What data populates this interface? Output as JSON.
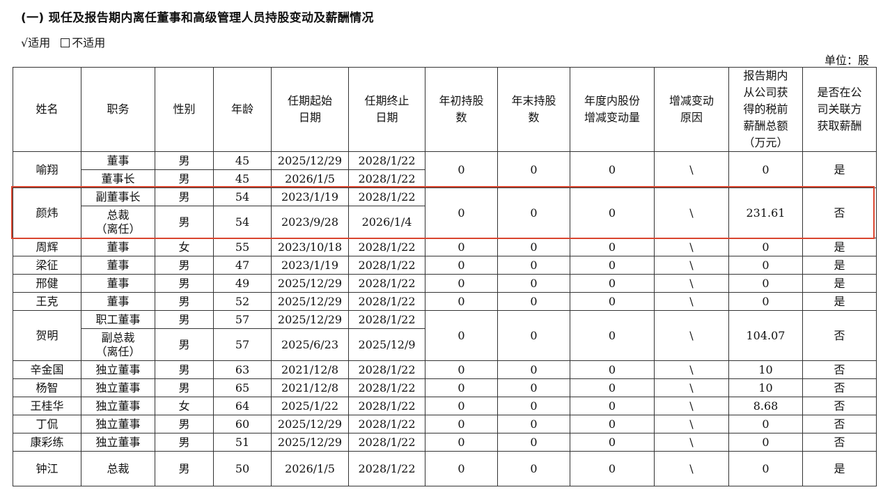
{
  "heading": "(一) 现任及报告期内离任董事和高级管理人员持股变动及薪酬情况",
  "applicability": {
    "checked": "√适用",
    "unchecked": "不适用"
  },
  "unit": "单位：股",
  "columns": [
    [
      "姓名"
    ],
    [
      "职务"
    ],
    [
      "性别"
    ],
    [
      "年龄"
    ],
    [
      "任期起始",
      "日期"
    ],
    [
      "任期终止",
      "日期"
    ],
    [
      "年初持股",
      "数"
    ],
    [
      "年末持股",
      "数"
    ],
    [
      "年度内股份",
      "增减变动量"
    ],
    [
      "增减变动",
      "原因"
    ],
    [
      "报告期内",
      "从公司获",
      "得的税前",
      "薪酬总额",
      "（万元）"
    ],
    [
      "是否在公",
      "司关联方",
      "获取薪酬"
    ]
  ],
  "persons": [
    {
      "name": "喻翔",
      "shares_begin": "0",
      "shares_end": "0",
      "change": "0",
      "reason": "\\",
      "pay": "0",
      "related": "是",
      "roles": [
        {
          "title": [
            "董事"
          ],
          "gender": "男",
          "age": "45",
          "start": "2025/12/29",
          "end": "2028/1/22"
        },
        {
          "title": [
            "董事长"
          ],
          "gender": "男",
          "age": "45",
          "start": "2026/1/5",
          "end": "2028/1/22"
        }
      ]
    },
    {
      "name": "颜炜",
      "shares_begin": "0",
      "shares_end": "0",
      "change": "0",
      "reason": "\\",
      "pay": "231.61",
      "related": "否",
      "roles": [
        {
          "title": [
            "副董事长"
          ],
          "gender": "男",
          "age": "54",
          "start": "2023/1/19",
          "end": "2028/1/22"
        },
        {
          "title": [
            "总裁",
            "（离任）"
          ],
          "gender": "男",
          "age": "54",
          "start": "2023/9/28",
          "end": "2026/1/4"
        }
      ]
    },
    {
      "name": "周辉",
      "shares_begin": "0",
      "shares_end": "0",
      "change": "0",
      "reason": "\\",
      "pay": "0",
      "related": "是",
      "roles": [
        {
          "title": [
            "董事"
          ],
          "gender": "女",
          "age": "55",
          "start": "2023/10/18",
          "end": "2028/1/22"
        }
      ]
    },
    {
      "name": "梁征",
      "shares_begin": "0",
      "shares_end": "0",
      "change": "0",
      "reason": "\\",
      "pay": "0",
      "related": "是",
      "roles": [
        {
          "title": [
            "董事"
          ],
          "gender": "男",
          "age": "47",
          "start": "2023/1/19",
          "end": "2028/1/22"
        }
      ]
    },
    {
      "name": "邢健",
      "shares_begin": "0",
      "shares_end": "0",
      "change": "0",
      "reason": "\\",
      "pay": "0",
      "related": "是",
      "roles": [
        {
          "title": [
            "董事"
          ],
          "gender": "男",
          "age": "49",
          "start": "2025/12/29",
          "end": "2028/1/22"
        }
      ]
    },
    {
      "name": "王克",
      "shares_begin": "0",
      "shares_end": "0",
      "change": "0",
      "reason": "\\",
      "pay": "0",
      "related": "是",
      "roles": [
        {
          "title": [
            "董事"
          ],
          "gender": "男",
          "age": "52",
          "start": "2025/12/29",
          "end": "2028/1/22"
        }
      ]
    },
    {
      "name": "贺明",
      "shares_begin": "0",
      "shares_end": "0",
      "change": "0",
      "reason": "\\",
      "pay": "104.07",
      "related": "否",
      "roles": [
        {
          "title": [
            "职工董事"
          ],
          "gender": "男",
          "age": "57",
          "start": "2025/12/29",
          "end": "2028/1/22"
        },
        {
          "title": [
            "副总裁",
            "（离任）"
          ],
          "gender": "男",
          "age": "57",
          "start": "2025/6/23",
          "end": "2025/12/9"
        }
      ]
    },
    {
      "name": "辛金国",
      "shares_begin": "0",
      "shares_end": "0",
      "change": "0",
      "reason": "\\",
      "pay": "10",
      "related": "否",
      "roles": [
        {
          "title": [
            "独立董事"
          ],
          "gender": "男",
          "age": "63",
          "start": "2021/12/8",
          "end": "2028/1/22"
        }
      ]
    },
    {
      "name": "杨智",
      "shares_begin": "0",
      "shares_end": "0",
      "change": "0",
      "reason": "\\",
      "pay": "10",
      "related": "否",
      "roles": [
        {
          "title": [
            "独立董事"
          ],
          "gender": "男",
          "age": "65",
          "start": "2021/12/8",
          "end": "2028/1/22"
        }
      ]
    },
    {
      "name": "王桂华",
      "shares_begin": "0",
      "shares_end": "0",
      "change": "0",
      "reason": "\\",
      "pay": "8.68",
      "related": "否",
      "roles": [
        {
          "title": [
            "独立董事"
          ],
          "gender": "女",
          "age": "64",
          "start": "2025/1/22",
          "end": "2028/1/22"
        }
      ]
    },
    {
      "name": "丁侃",
      "shares_begin": "0",
      "shares_end": "0",
      "change": "0",
      "reason": "\\",
      "pay": "0",
      "related": "否",
      "roles": [
        {
          "title": [
            "独立董事"
          ],
          "gender": "男",
          "age": "60",
          "start": "2025/12/29",
          "end": "2028/1/22"
        }
      ]
    },
    {
      "name": "康彩练",
      "shares_begin": "0",
      "shares_end": "0",
      "change": "0",
      "reason": "\\",
      "pay": "0",
      "related": "否",
      "roles": [
        {
          "title": [
            "独立董事"
          ],
          "gender": "男",
          "age": "51",
          "start": "2025/12/29",
          "end": "2028/1/22"
        }
      ]
    },
    {
      "name": "钟江",
      "shares_begin": "0",
      "shares_end": "0",
      "change": "0",
      "reason": "\\",
      "pay": "0",
      "related": "是",
      "roles": [
        {
          "title": [
            "总裁"
          ],
          "gender": "男",
          "age": "50",
          "start": "2026/1/5",
          "end": "2028/1/22"
        }
      ]
    }
  ],
  "highlight_color": "#d9452f"
}
